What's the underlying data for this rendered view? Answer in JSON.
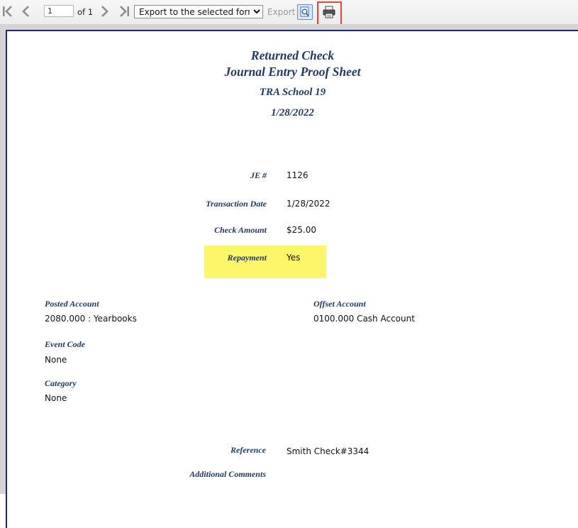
{
  "toolbar": {
    "page_current": "1",
    "page_of": "of 1",
    "export_select_value": "Export to the selected format",
    "export_label": "Export"
  },
  "report": {
    "title_line1": "Returned Check",
    "title_line2": "Journal Entry Proof Sheet",
    "school": "TRA School 19",
    "date": "1/28/2022",
    "fields": {
      "je_label": "JE #",
      "je_value": "1126",
      "transaction_date_label": "Transaction Date",
      "transaction_date_value": "1/28/2022",
      "check_amount_label": "Check Amount",
      "check_amount_value": "$25.00",
      "repayment_label": "Repayment",
      "repayment_value": "Yes"
    },
    "accounts": {
      "posted_label": "Posted Account",
      "posted_value": "2080.000 : Yearbooks",
      "offset_label": "Offset Account",
      "offset_value": "0100.000 Cash Account",
      "event_code_label": "Event Code",
      "event_code_value": "None",
      "category_label": "Category",
      "category_value": "None"
    },
    "reference_label": "Reference",
    "reference_value": "Smith Check#3344",
    "comments_label": "Additional Comments"
  },
  "colors": {
    "label_blue": "#1f3a66",
    "highlight_yellow": "#fdf668",
    "print_highlight_red": "#e8453a"
  }
}
